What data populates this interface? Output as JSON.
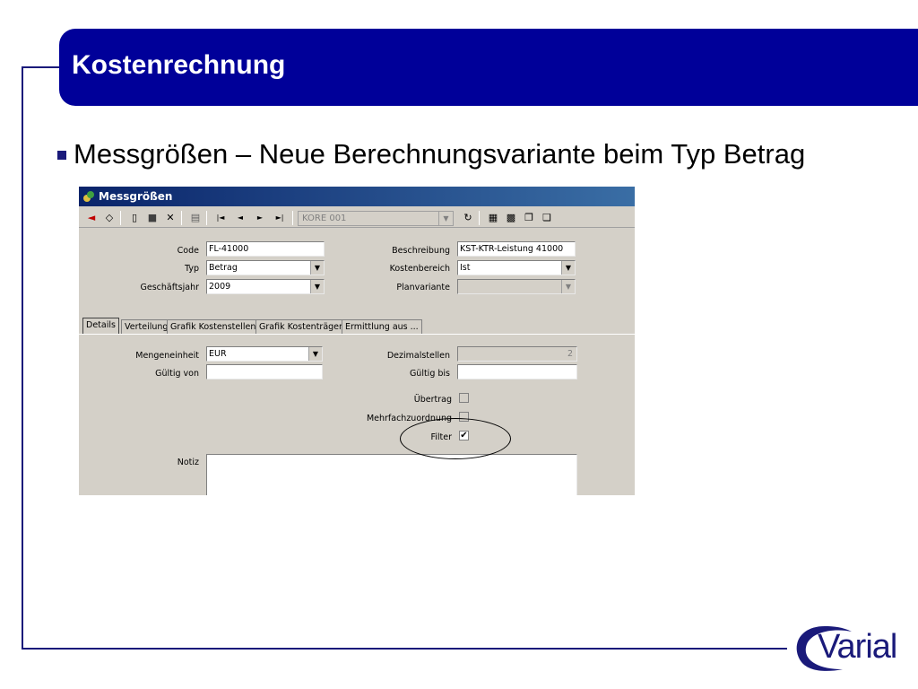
{
  "slide": {
    "title": "Kostenrechnung",
    "bullet": "Messgrößen – Neue Berechnungsvariante beim Typ Betrag",
    "logo": "Varial"
  },
  "window": {
    "title": "Messgrößen",
    "toolbar_combo_value": "KORE 001"
  },
  "form": {
    "code_label": "Code",
    "code_value": "FL-41000",
    "typ_label": "Typ",
    "typ_value": "Betrag",
    "jahr_label": "Geschäftsjahr",
    "jahr_value": "2009",
    "beschreibung_label": "Beschreibung",
    "beschreibung_value": "KST-KTR-Leistung 41000",
    "kostenbereich_label": "Kostenbereich",
    "kostenbereich_value": "Ist",
    "planvariante_label": "Planvariante",
    "planvariante_value": ""
  },
  "tabs": [
    "Details",
    "Verteilung",
    "Grafik Kostenstellen",
    "Grafik Kostenträger",
    "Ermittlung aus ..."
  ],
  "details": {
    "mengeneinheit_label": "Mengeneinheit",
    "mengeneinheit_value": "EUR",
    "gueltig_von_label": "Gültig von",
    "gueltig_von_value": "",
    "dezimalstellen_label": "Dezimalstellen",
    "dezimalstellen_value": "2",
    "gueltig_bis_label": "Gültig bis",
    "gueltig_bis_value": "",
    "uebertrag_label": "Übertrag",
    "uebertrag_checked": false,
    "mehrfach_label": "Mehrfachzuordnung",
    "mehrfach_checked": false,
    "filter_label": "Filter",
    "filter_checked": true,
    "filter_mark": "✔",
    "notiz_label": "Notiz",
    "notiz_value": ""
  }
}
